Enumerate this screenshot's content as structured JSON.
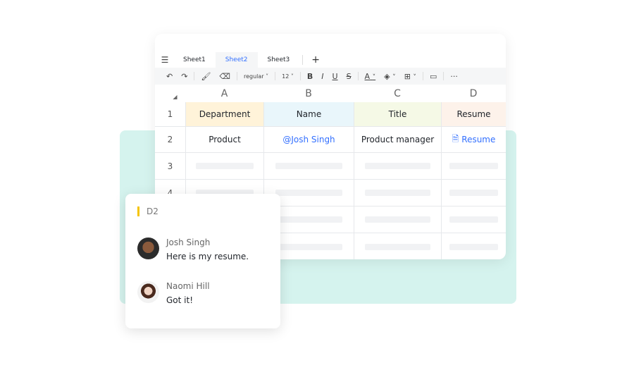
{
  "tabs": [
    "Sheet1",
    "Sheet2",
    "Sheet3"
  ],
  "active_tab": "Sheet2",
  "toolbar": {
    "font_style": "regular",
    "font_size": "12",
    "bold": "B",
    "italic": "I",
    "underline": "U",
    "strike": "S",
    "text_color": "A",
    "more": "···"
  },
  "columns": [
    "A",
    "B",
    "C",
    "D"
  ],
  "row_numbers": [
    "1",
    "2",
    "3",
    "4"
  ],
  "header_row": [
    "Department",
    "Name",
    "Title",
    "Resume"
  ],
  "header_colors": [
    "#fff3d9",
    "#e9f6fb",
    "#f5f9e6",
    "#fdf2ea"
  ],
  "data_row": {
    "department": "Product",
    "name": "@Josh Singh",
    "title": "Product manager",
    "resume": "Resume"
  },
  "comment": {
    "cell": "D2",
    "messages": [
      {
        "author": "Josh Singh",
        "text": "Here is my resume."
      },
      {
        "author": "Naomi Hill",
        "text": "Got it!"
      }
    ]
  },
  "colors": {
    "accent": "#3370ff",
    "teal": "#d5f3ee",
    "marker": "#f5c400"
  }
}
